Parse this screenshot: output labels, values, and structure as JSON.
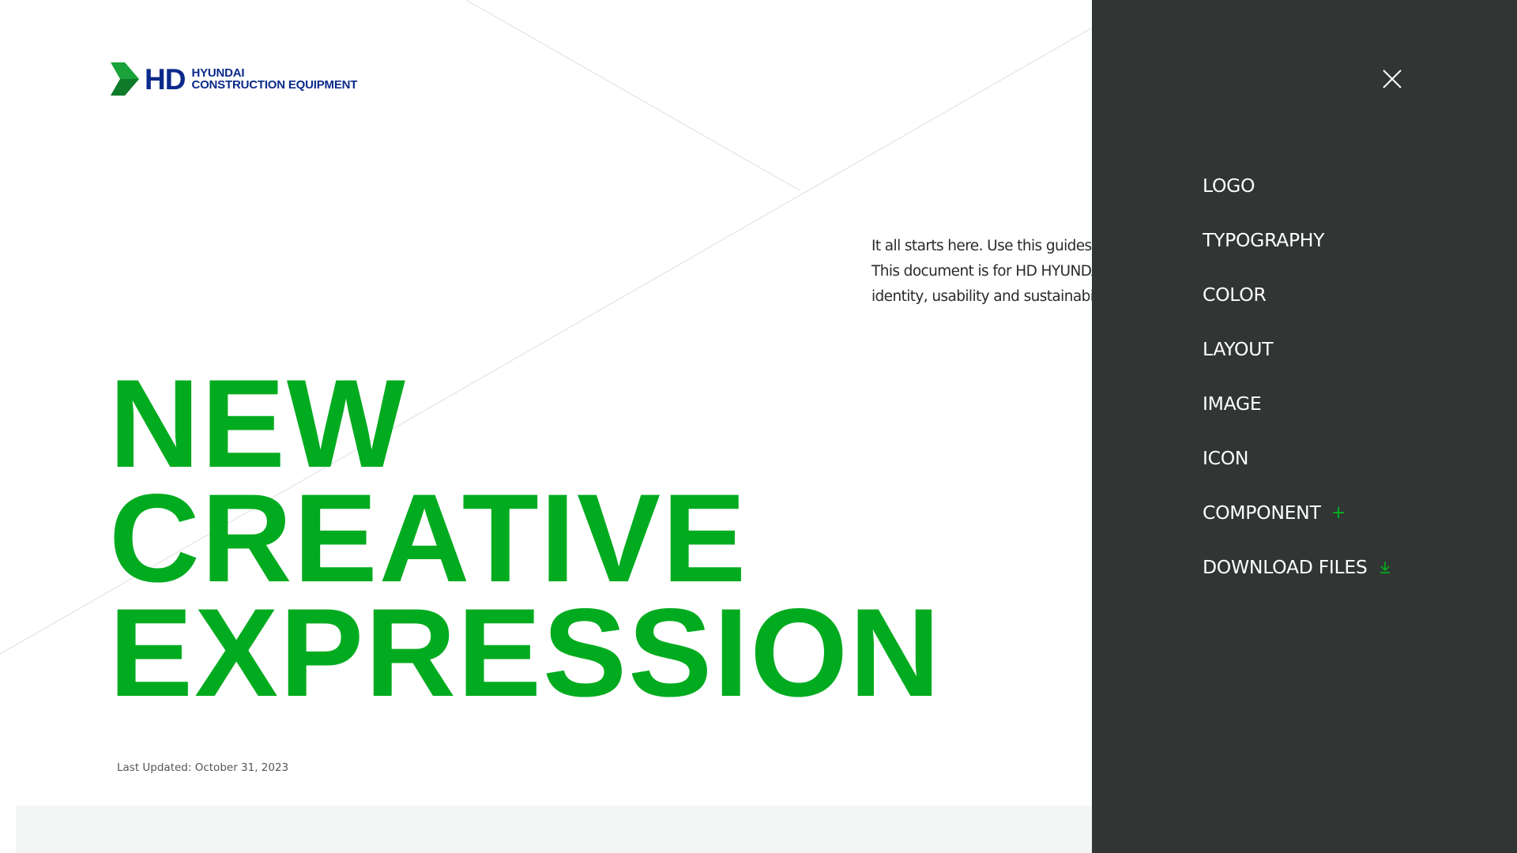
{
  "brand": {
    "short": "HD",
    "line1": "HYUNDAI",
    "line2": "CONSTRUCTION EQUIPMENT"
  },
  "intro": {
    "line1": "It all starts here. Use this guides as a",
    "line2": "This document is for HD HYUNDAI CON",
    "line3": "identity, usability and sustainability."
  },
  "hero": {
    "line1": "NEW",
    "line2": "CREATIVE",
    "line3": "EXPRESSION"
  },
  "last_updated": "Last Updated: October 31, 2023",
  "menu": {
    "items": [
      {
        "label": "LOGO"
      },
      {
        "label": "TYPOGRAPHY"
      },
      {
        "label": "COLOR"
      },
      {
        "label": "LAYOUT"
      },
      {
        "label": "IMAGE"
      },
      {
        "label": "ICON"
      },
      {
        "label": "COMPONENT",
        "icon": "plus-icon"
      },
      {
        "label": "DOWNLOAD FILES",
        "icon": "download-icon"
      }
    ],
    "close_icon": "close-icon"
  },
  "colors": {
    "accent_green": "#00ab1f",
    "brand_navy": "#0a2a8a",
    "panel_bg": "#313533",
    "footer_bg": "#f4f6f5"
  }
}
